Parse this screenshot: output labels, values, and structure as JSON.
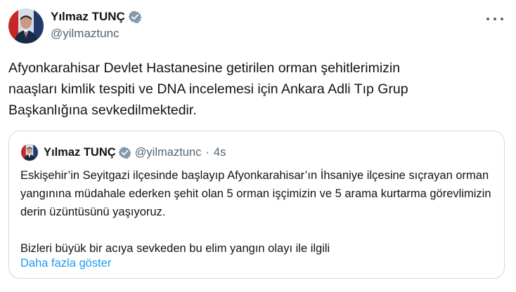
{
  "tweet": {
    "author": {
      "display_name": "Yılmaz TUNÇ",
      "handle": "@yilmaztunc",
      "verified_icon": "verified-badge-icon",
      "avatar": "avatar"
    },
    "more_icon": "more-options-icon",
    "text": "Afyonkarahisar Devlet Hastanesine getirilen orman şehitlerimizin\nnaaşları kimlik tespiti ve DNA incelemesi için Ankara Adli Tıp Grup\nBaşkanlığına sevkedilmektedir."
  },
  "quote": {
    "author": {
      "display_name": "Yılmaz TUNÇ",
      "handle": "@yilmaztunc",
      "separator": "·",
      "time": "4s"
    },
    "paragraphs": [
      "Eskişehir’in Seyitgazi ilçesinde başlayıp Afyonkarahisar’ın İhsaniye ilçesine sıçrayan orman yangınına müdahale ederken şehit olan 5 orman işçimizin ve 5 arama kurtarma görevlimizin derin üzüntüsünü yaşıyoruz.",
      "Bizleri büyük bir acıya sevkeden bu elim yangın olayı ile ilgili"
    ],
    "show_more": "Daha fazla göster"
  },
  "colors": {
    "text": "#0f1419",
    "secondary": "#536471",
    "link": "#1d9bf0",
    "verified": "#829aab",
    "border": "#cfd9de"
  }
}
